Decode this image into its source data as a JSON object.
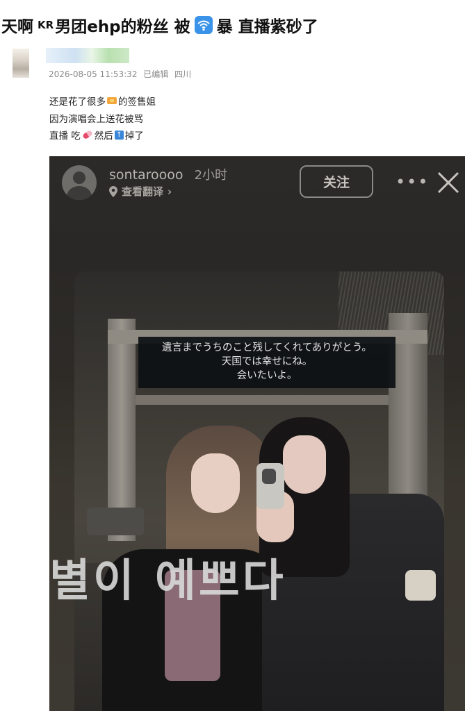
{
  "post": {
    "title": {
      "prefix": "天啊",
      "badge": "KR",
      "middle": "男团ehp的粉丝 被",
      "icon": "wifi-icon",
      "suffix": "暴 直播紫砂了"
    },
    "author": {
      "avatar_icon": "avatar",
      "name_blurred": true
    },
    "meta": {
      "datetime": "2026-08-05 11:53:32",
      "edited": "已编辑",
      "location": "四川"
    },
    "lines": [
      {
        "before": "还是花了很多",
        "emoji": "money-icon",
        "after": "的签售姐"
      },
      {
        "before": "因为演唱会上送花被骂",
        "emoji": "",
        "after": ""
      },
      {
        "before": "直播 吃",
        "emoji": "pill-icon",
        "after": " 然后",
        "emoji2": "up-arrow-icon",
        "after2": "掉了"
      }
    ]
  },
  "screenshot": {
    "username": "sontaroooo",
    "time": "2小时",
    "translate": "查看翻译",
    "follow": "关注",
    "caption": [
      "遺言までうちのこと残してくれてありがとう。",
      "天国では幸せにね。",
      "会いたいよ。"
    ],
    "overlay_korean": "별이 예쁘다"
  },
  "colors": {
    "wifi_badge": "#3a93e8",
    "meta_text": "#8a8a8a",
    "screenshot_bg": "#2b2a28"
  }
}
